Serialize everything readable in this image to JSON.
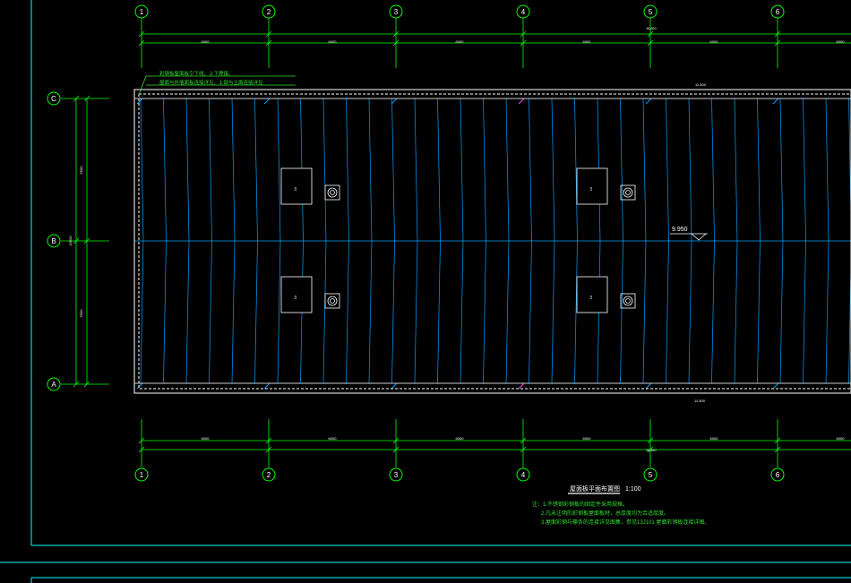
{
  "drawing": {
    "title": "屋面板平面布置图",
    "scale": "1:100",
    "colors": {
      "background": "#000000",
      "axis": "#00ff00",
      "dim_text": "#ffffff",
      "frame": "#00ffff",
      "panel_lines": "#00a0ff",
      "slab_outline": "#ffffff",
      "notes": "#33dd33",
      "annotation": "#33dd33",
      "magenta": "#ff44ff"
    },
    "grid_columns": [
      "1",
      "2",
      "3",
      "4",
      "5",
      "6"
    ],
    "grid_rows": [
      "C",
      "B",
      "A"
    ],
    "top_dims": [
      "6000",
      "6000",
      "6000",
      "6000",
      "6000",
      "6000"
    ],
    "top_total": "61400",
    "bottom_dims": [
      "6000",
      "6000",
      "6000",
      "6000",
      "6000",
      "6000"
    ],
    "bottom_total": "61400",
    "left_dims": [
      "5500",
      "5500"
    ],
    "left_total": "15500",
    "top_annotation_1": "彩钢板屋面板引下线，上下焊接。",
    "top_annotation_2": "屋面与外墙面板连接详见，上部与立面连接详见",
    "elevation_top": "11.500",
    "elevation_mid": "9.950",
    "elevation_bottom": "11.500",
    "equipment_labels": [
      "1#",
      "1#",
      "1#",
      "1#"
    ],
    "notes": [
      "注：1.不锈钢彩钢板的固定件采用规格。",
      "2.凡未注明的彩钢板屋面板材，总厚度均为合适厚度。",
      "3.屋面彩钢与檩条的连接详见图集，参见13J101 屋面彩钢板连接详图。"
    ]
  }
}
